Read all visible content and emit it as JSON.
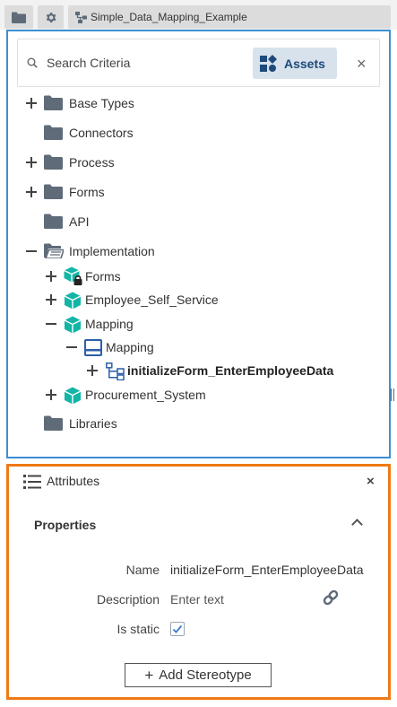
{
  "topbar": {
    "tab_label": "Simple_Data_Mapping_Example"
  },
  "search": {
    "placeholder": "Search Criteria",
    "assets_label": "Assets",
    "close_glyph": "×"
  },
  "tree": {
    "items": [
      {
        "label": "Base Types",
        "toggle": "plus",
        "icon": "folder-icon",
        "level": 0
      },
      {
        "label": "Connectors",
        "toggle": "none",
        "icon": "folder-icon",
        "level": 0
      },
      {
        "label": "Process",
        "toggle": "plus",
        "icon": "folder-icon",
        "level": 0
      },
      {
        "label": "Forms",
        "toggle": "plus",
        "icon": "folder-icon",
        "level": 0
      },
      {
        "label": "API",
        "toggle": "none",
        "icon": "folder-icon",
        "level": 0
      },
      {
        "label": "Implementation",
        "toggle": "minus",
        "icon": "folder-open-icon",
        "level": 0
      },
      {
        "label": "Forms",
        "toggle": "plus",
        "icon": "locked-package-icon",
        "level": 1
      },
      {
        "label": "Employee_Self_Service",
        "toggle": "plus",
        "icon": "package-icon",
        "level": 1
      },
      {
        "label": "Mapping",
        "toggle": "minus",
        "icon": "package-icon",
        "level": 1
      },
      {
        "label": "Mapping",
        "toggle": "minus",
        "icon": "mapping-icon",
        "level": 2
      },
      {
        "label": "initializeForm_EnterEmployeeData",
        "toggle": "plus",
        "icon": "mapping-node-icon",
        "level": 3,
        "selected": true
      },
      {
        "label": "Procurement_System",
        "toggle": "plus",
        "icon": "package-icon",
        "level": 1
      },
      {
        "label": "Libraries",
        "toggle": "none",
        "icon": "folder-icon",
        "level": 0
      }
    ]
  },
  "attributes": {
    "title": "Attributes",
    "close_glyph": "×",
    "section_title": "Properties",
    "name_label": "Name",
    "name_value": "initializeForm_EnterEmployeeData",
    "description_label": "Description",
    "description_placeholder": "Enter text",
    "is_static_label": "Is static",
    "is_static_checked": true,
    "add_stereotype_label": "Add Stereotype",
    "add_stereotype_glyph": "+"
  },
  "colors": {
    "tree_panel_border": "#3b8fd4",
    "attributes_panel_border": "#ee7a15",
    "package_teal": "#13b5a6",
    "folder_gray": "#5f6b78",
    "mapping_blue": "#2b5fa8"
  }
}
